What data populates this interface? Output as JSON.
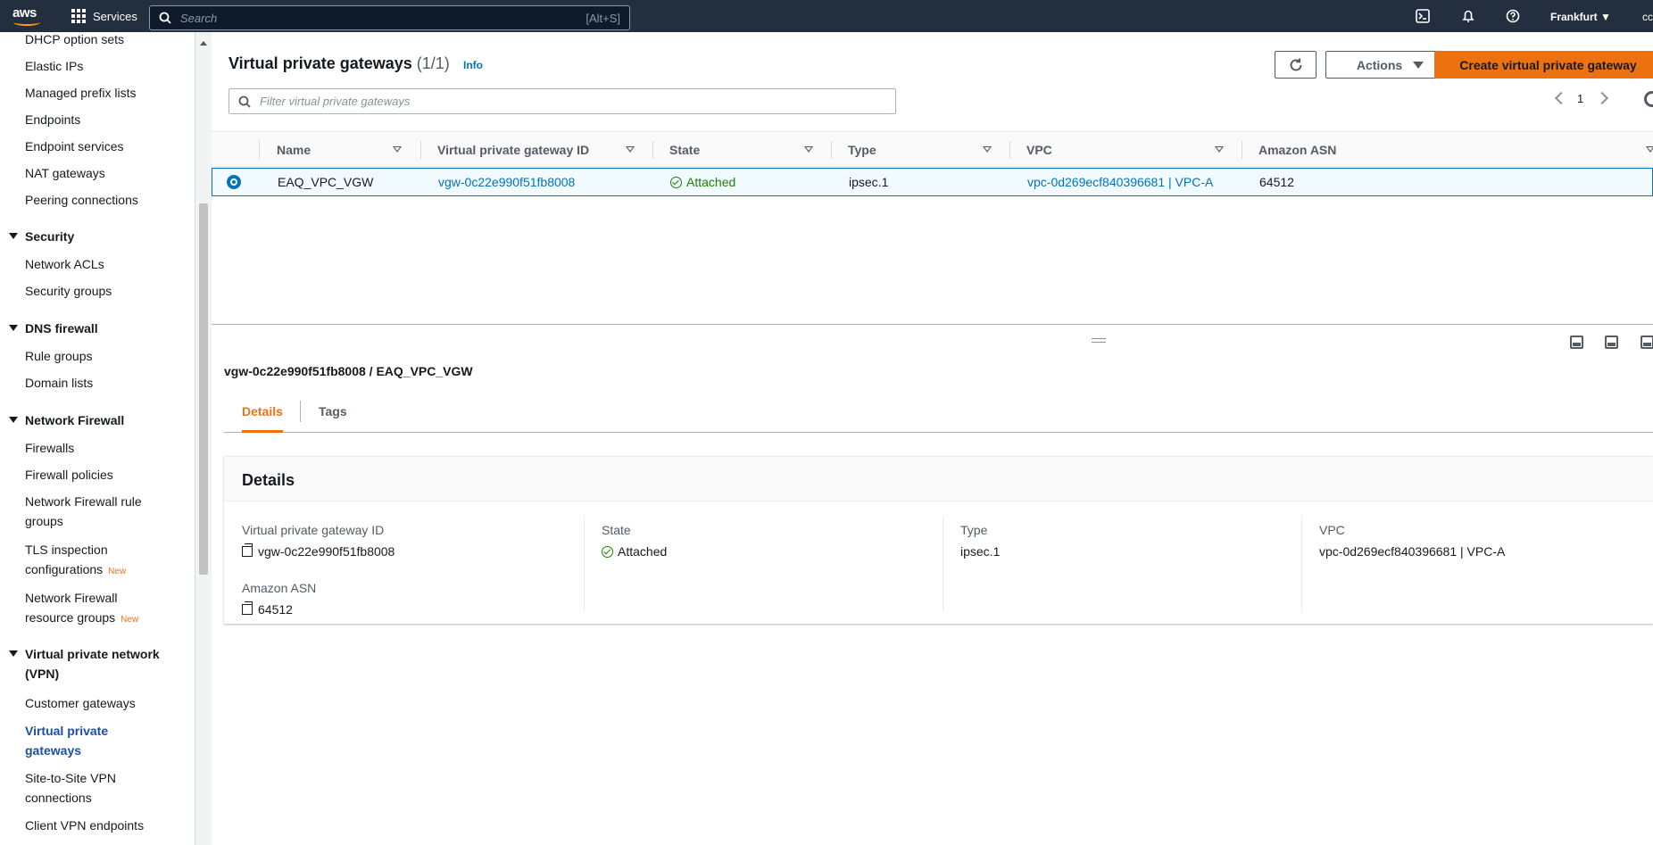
{
  "topnav": {
    "logo_text": "aws",
    "services_label": "Services",
    "search_placeholder": "Search",
    "search_shortcut": "[Alt+S]",
    "region": "Frankfurt ▼",
    "account": "cc"
  },
  "sidebar": {
    "items": [
      {
        "label": "DHCP option sets"
      },
      {
        "label": "Elastic IPs"
      },
      {
        "label": "Managed prefix lists"
      },
      {
        "label": "Endpoints"
      },
      {
        "label": "Endpoint services"
      },
      {
        "label": "NAT gateways"
      },
      {
        "label": "Peering connections"
      }
    ],
    "security": {
      "heading": "Security",
      "items": [
        "Network ACLs",
        "Security groups"
      ]
    },
    "dns_firewall": {
      "heading": "DNS firewall",
      "items": [
        "Rule groups",
        "Domain lists"
      ]
    },
    "network_firewall": {
      "heading": "Network Firewall",
      "items": [
        "Firewalls",
        "Firewall policies",
        "Network Firewall rule",
        "groups",
        "TLS inspection",
        "configurations",
        "Network Firewall",
        "resource groups"
      ],
      "new_badge": "New"
    },
    "vpn": {
      "heading_line1": "Virtual private network",
      "heading_line2": "(VPN)",
      "items": [
        "Customer gateways",
        "Virtual private",
        "gateways",
        "Site-to-Site VPN",
        "connections",
        "Client VPN endpoints"
      ]
    }
  },
  "header": {
    "title": "Virtual private gateways",
    "count": "(1/1)",
    "info": "Info",
    "actions_label": "Actions",
    "create_label": "Create virtual private gateway",
    "filter_placeholder": "Filter virtual private gateways",
    "page": "1"
  },
  "table": {
    "columns": [
      "Name",
      "Virtual private gateway ID",
      "State",
      "Type",
      "VPC",
      "Amazon ASN"
    ],
    "rows": [
      {
        "name": "EAQ_VPC_VGW",
        "id": "vgw-0c22e990f51fb8008",
        "state": "Attached",
        "type": "ipsec.1",
        "vpc": "vpc-0d269ecf840396681 | VPC-A",
        "asn": "64512"
      }
    ]
  },
  "details": {
    "subtitle": "vgw-0c22e990f51fb8008 / EAQ_VPC_VGW",
    "tabs": [
      "Details",
      "Tags"
    ],
    "card_title": "Details",
    "fields": {
      "id_label": "Virtual private gateway ID",
      "id_value": "vgw-0c22e990f51fb8008",
      "asn_label": "Amazon ASN",
      "asn_value": "64512",
      "state_label": "State",
      "state_value": "Attached",
      "type_label": "Type",
      "type_value": "ipsec.1",
      "vpc_label": "VPC",
      "vpc_value": "vpc-0d269ecf840396681 | VPC-A"
    }
  },
  "colors": {
    "nav_bg": "#232f3e",
    "primary_orange": "#ec7211",
    "link_blue": "#0073bb",
    "success_green": "#1d8102"
  }
}
